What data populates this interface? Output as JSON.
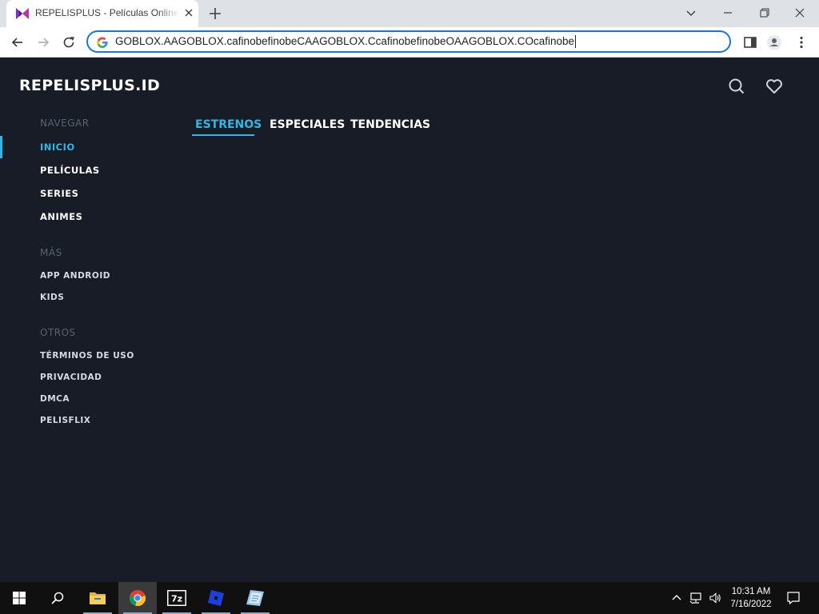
{
  "browser": {
    "tab": {
      "title": "REPELISPLUS - Películas Online en HD",
      "favicon": "repelisplus-logo-icon"
    },
    "omnibox": {
      "url": "GOBLOX.AAGOBLOX.cafinobefinobeCAAGOBLOX.CcafinobefinobeOAAGOBLOX.COcafinobe"
    },
    "accent": "#1a73e8"
  },
  "site": {
    "logo": "REPELISPLUS.ID",
    "accent": "#2fb7e6",
    "background": "#171c26",
    "sidebar": {
      "navegar": {
        "heading": "NAVEGAR",
        "items": [
          {
            "label": "INICIO",
            "active": true
          },
          {
            "label": "PELÍCULAS"
          },
          {
            "label": "SERIES"
          },
          {
            "label": "ANIMES"
          }
        ]
      },
      "mas": {
        "heading": "MÁS",
        "items": [
          {
            "label": "APP ANDROID"
          },
          {
            "label": "KIDS"
          }
        ]
      },
      "otros": {
        "heading": "OTROS",
        "items": [
          {
            "label": "TÉRMINOS DE USO"
          },
          {
            "label": "PRIVACIDAD"
          },
          {
            "label": "DMCA"
          },
          {
            "label": "PELISFLIX"
          }
        ]
      }
    },
    "content_tabs": [
      {
        "label": "ESTRENOS",
        "active": true
      },
      {
        "label": "ESPECIALES"
      },
      {
        "label": "TENDENCIAS"
      }
    ],
    "header_icons": [
      "search-icon",
      "heart-icon"
    ]
  },
  "taskbar": {
    "apps": [
      "start-icon",
      "search-icon",
      "file-explorer-icon",
      "chrome-icon",
      "7zip-icon",
      "roblox-icon",
      "app-icon"
    ],
    "clock": {
      "time": "10:31 AM",
      "date": "7/16/2022"
    }
  }
}
